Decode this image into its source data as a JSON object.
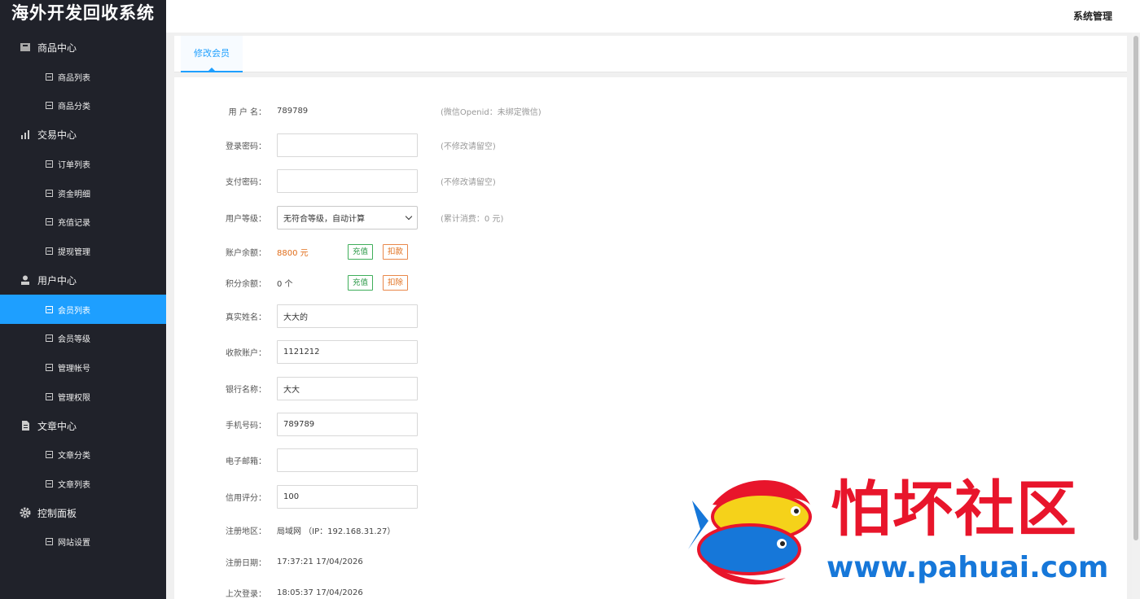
{
  "app": {
    "title": "海外开发回收系统"
  },
  "header": {
    "admin_label": "系统管理"
  },
  "sidebar": {
    "groups": [
      {
        "label": "商品中心",
        "icon": "box-icon",
        "items": [
          "商品列表",
          "商品分类"
        ]
      },
      {
        "label": "交易中心",
        "icon": "bar-chart-icon",
        "items": [
          "订单列表",
          "资金明细",
          "充值记录",
          "提现管理"
        ]
      },
      {
        "label": "用户中心",
        "icon": "user-icon",
        "items": [
          "会员列表",
          "会员等级",
          "管理帐号",
          "管理权限"
        ]
      },
      {
        "label": "文章中心",
        "icon": "document-icon",
        "items": [
          "文章分类",
          "文章列表"
        ]
      },
      {
        "label": "控制面板",
        "icon": "gear-icon",
        "items": [
          "网站设置"
        ]
      }
    ],
    "active_item": "会员列表"
  },
  "tabs": {
    "current": "修改会员"
  },
  "form": {
    "username": {
      "label": "用 户 名：",
      "value": "789789",
      "hint": "(微信Openid：未绑定微信)"
    },
    "login_password": {
      "label": "登录密码：",
      "value": "",
      "hint": "(不修改请留空)"
    },
    "pay_password": {
      "label": "支付密码：",
      "value": "",
      "hint": "(不修改请留空)"
    },
    "level": {
      "label": "用户等级：",
      "selected": "无符合等级，自动计算",
      "hint": "(累计消费：0 元)"
    },
    "balance": {
      "label": "账户余额：",
      "value": "8800 元",
      "recharge": "充值",
      "deduct": "扣款"
    },
    "points": {
      "label": "积分余额：",
      "value": "0 个",
      "recharge": "充值",
      "deduct": "扣除"
    },
    "real_name": {
      "label": "真实姓名：",
      "value": "大大的"
    },
    "account": {
      "label": "收款账户：",
      "value": "1121212"
    },
    "bank": {
      "label": "银行名称：",
      "value": "大大"
    },
    "phone": {
      "label": "手机号码：",
      "value": "789789"
    },
    "email": {
      "label": "电子邮箱：",
      "value": ""
    },
    "credit": {
      "label": "信用评分：",
      "value": "100"
    },
    "region": {
      "label": "注册地区：",
      "value": "局域网 （IP：192.168.31.27）"
    },
    "reg_date": {
      "label": "注册日期：",
      "value": "17:37:21 17/04/2026"
    },
    "last_login": {
      "label": "上次登录：",
      "value": "18:05:37 17/04/2026"
    }
  },
  "watermark": {
    "text": "怕坏社区",
    "url": "www.pahuai.com"
  },
  "colors": {
    "sidebar_bg": "#20222a",
    "active": "#1e9fff",
    "money": "#e06d1a",
    "green": "#2e9a4a"
  }
}
